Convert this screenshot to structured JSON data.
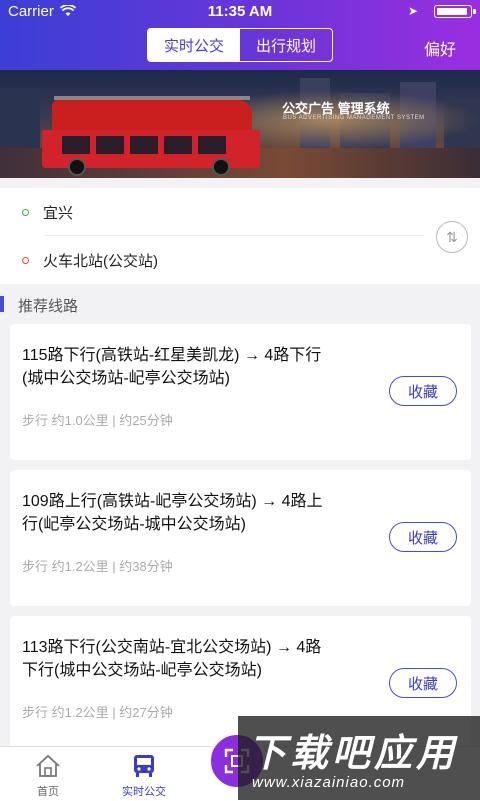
{
  "status": {
    "carrier": "Carrier",
    "time": "11:35 AM"
  },
  "nav": {
    "seg_realtime": "实时公交",
    "seg_plan": "出行规划",
    "pref": "偏好"
  },
  "banner": {
    "title": "公交广告 管理系统",
    "subtitle": "BUS ADVERTISING MANAGEMENT SYSTEM"
  },
  "stops": {
    "from": "宜兴",
    "to": "火车北站(公交站)",
    "from_dot": "#3cb24a",
    "to_dot": "#e04848"
  },
  "section": {
    "title": "推荐线路"
  },
  "routes": [
    {
      "line1": "115路下行(高铁站-红星美凯龙) → 4路下行",
      "line2": "(城中公交场站-屺亭公交场站)",
      "info": "步行  约1.0公里 | 约25分钟",
      "fav": "收藏"
    },
    {
      "line1": "109路上行(高铁站-屺亭公交场站) → 4路上",
      "line2": "行(屺亭公交场站-城中公交场站)",
      "info": "步行  约1.2公里 | 约38分钟",
      "fav": "收藏"
    },
    {
      "line1": "113路下行(公交南站-宜北公交场站) → 4路",
      "line2": "下行(城中公交场站-屺亭公交场站)",
      "info": "步行  约1.2公里 | 约27分钟",
      "fav": "收藏"
    }
  ],
  "tabs": {
    "home": "首页",
    "realtime": "实时公交",
    "tab4": "",
    "tab5": ""
  },
  "watermark": {
    "big": "下载吧应用",
    "small": "www.xiazainiao.com"
  },
  "colors": {
    "accent": "#4a4ad8",
    "gradient_start": "#3b3fd6",
    "gradient_end": "#9a2ee0"
  }
}
